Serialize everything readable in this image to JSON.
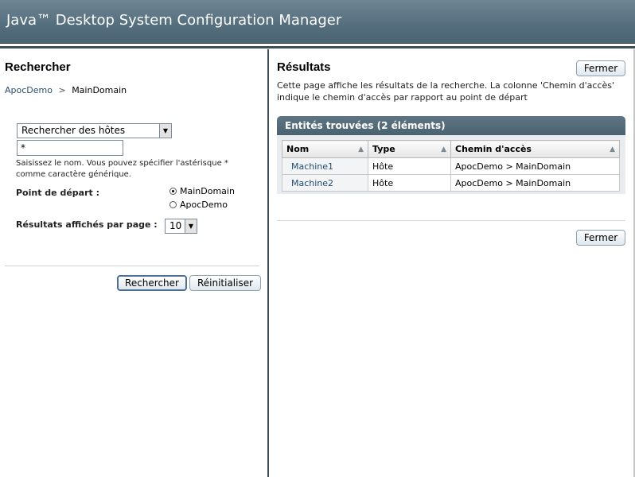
{
  "header": {
    "app_title": "Java™ Desktop System Configuration Manager"
  },
  "search": {
    "title": "Rechercher",
    "breadcrumb": {
      "root": "ApocDemo",
      "separator": ">",
      "current": "MainDomain"
    },
    "type_select": {
      "value": "Rechercher des hôtes"
    },
    "name_input": {
      "value": "*"
    },
    "help_text": "Saisissez le nom. Vous pouvez spécifier l'astérisque * comme caractère générique.",
    "start_label": "Point de départ :",
    "start_options": [
      {
        "label": "MainDomain",
        "checked": true
      },
      {
        "label": "ApocDemo",
        "checked": false
      }
    ],
    "per_page_label": "Résultats affichés par page :",
    "per_page_value": "10",
    "search_button": "Rechercher",
    "reset_button": "Réinitialiser"
  },
  "results": {
    "title": "Résultats",
    "close_button": "Fermer",
    "description": "Cette page affiche les résultats de la recherche. La colonne 'Chemin d'accès' indique le chemin d'accès par rapport au point de départ",
    "table_title": "Entités trouvées (2 éléments)",
    "columns": [
      "Nom",
      "Type",
      "Chemin d'accès"
    ],
    "rows": [
      {
        "name": "Machine1",
        "type": "Hôte",
        "path": "ApocDemo > MainDomain"
      },
      {
        "name": "Machine2",
        "type": "Hôte",
        "path": "ApocDemo > MainDomain"
      }
    ],
    "close_button_bottom": "Fermer"
  },
  "icons": {
    "sort": "sort-ascending-icon",
    "dropdown": "chevron-down-icon",
    "radio": "radio-icon"
  },
  "colors": {
    "header": "#56707f",
    "accent": "#2b4e73",
    "divider": "#3f4f5a"
  }
}
